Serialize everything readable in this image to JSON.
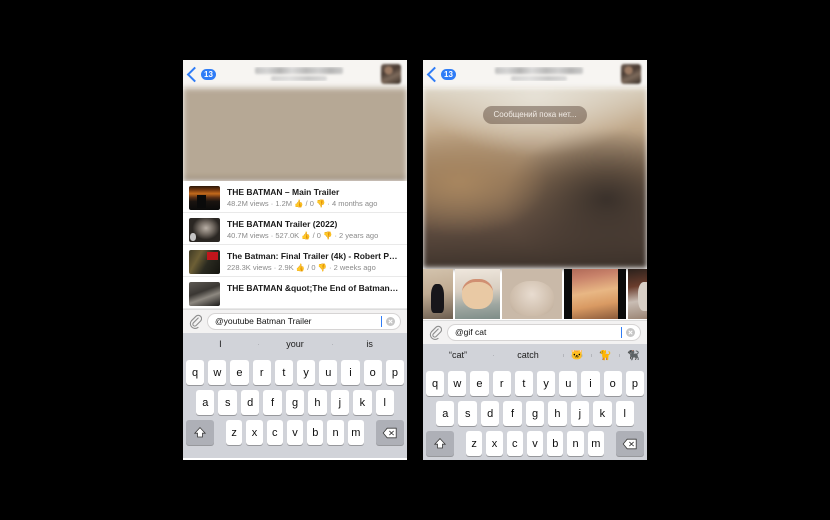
{
  "left_panel": {
    "nav": {
      "back_badge": "13",
      "back_icon": "chevron-left-icon",
      "avatar_icon": "avatar-image"
    },
    "videos": [
      {
        "title": "THE BATMAN – Main Trailer",
        "stats": "48.2M views · 1.2M 👍 / 0 👎 · 4 months ago"
      },
      {
        "title": "THE BATMAN Trailer (2022)",
        "stats": "40.7M views · 527.0K 👍 / 0 👎 · 2 years ago"
      },
      {
        "title": "The Batman: Final Trailer (4k) - Robert Patti...",
        "stats": "228.3K views · 2.9K 👍 / 0 👎 · 2 weeks ago"
      },
      {
        "title": "THE BATMAN &quot;The End of Batman&q...",
        "stats": ""
      }
    ],
    "input": {
      "attach_icon": "paperclip-icon",
      "value": "@youtube Batman Trailer",
      "clear_icon": "clear-icon"
    },
    "suggestions": [
      "I",
      "your",
      "is"
    ]
  },
  "right_panel": {
    "nav": {
      "back_badge": "13",
      "back_icon": "chevron-left-icon",
      "avatar_icon": "avatar-image"
    },
    "empty_state": "Сообщений пока нет...",
    "gifs": [
      {
        "name": "gif-black-cat"
      },
      {
        "name": "gif-cat-plush"
      },
      {
        "name": "gif-cream-cat"
      },
      {
        "name": "gif-orange-cat"
      },
      {
        "name": "gif-cat-chair"
      }
    ],
    "input": {
      "attach_icon": "paperclip-icon",
      "value": "@gif cat",
      "clear_icon": "clear-icon"
    },
    "suggestions": [
      "“cat”",
      "catch"
    ],
    "emoji_suggestions": [
      "🐱",
      "🐈",
      "🐈‍⬛"
    ]
  },
  "keyboard": {
    "row1": [
      "q",
      "w",
      "e",
      "r",
      "t",
      "y",
      "u",
      "i",
      "o",
      "p"
    ],
    "row2": [
      "a",
      "s",
      "d",
      "f",
      "g",
      "h",
      "j",
      "k",
      "l"
    ],
    "row3": [
      "z",
      "x",
      "c",
      "v",
      "b",
      "n",
      "m"
    ],
    "shift_icon": "shift-icon",
    "backspace_icon": "backspace-icon"
  },
  "colors": {
    "accent_blue": "#2f7cf6",
    "keyboard_bg": "#d1d3d9",
    "key_bg": "#ffffff",
    "modifier_key_bg": "#aeb0b7",
    "nav_bg": "#f7f5f2",
    "input_bar_bg": "#f3f2f2",
    "canvas_bg": "#000000"
  }
}
